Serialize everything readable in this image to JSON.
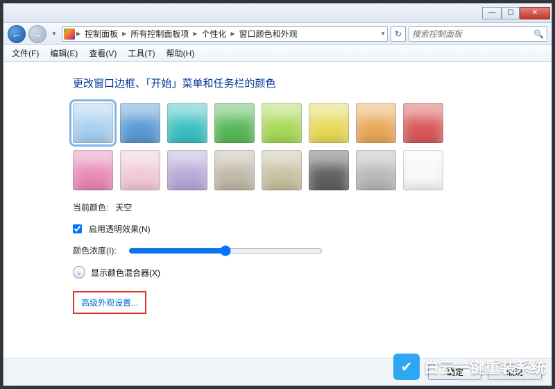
{
  "titlebar": {
    "minimize": "—",
    "maximize": "☐",
    "close": "✕"
  },
  "nav": {
    "back_icon": "←",
    "forward_icon": "→",
    "dropdown": "▼",
    "crumbs": [
      "控制面板",
      "所有控制面板项",
      "个性化",
      "窗口颜色和外观"
    ],
    "refresh_icon": "↻",
    "search_placeholder": "搜索控制面板",
    "search_icon": "🔍"
  },
  "menu": {
    "file": "文件(F)",
    "edit": "编辑(E)",
    "view": "查看(V)",
    "tools": "工具(T)",
    "help": "帮助(H)"
  },
  "page": {
    "heading": "更改窗口边框、「开始」菜单和任务栏的颜色",
    "swatches": [
      {
        "name": "天空",
        "hex": "#a8d0f0",
        "selected": true
      },
      {
        "name": "蓝",
        "hex": "#5a9ad4"
      },
      {
        "name": "青",
        "hex": "#3cc0c0"
      },
      {
        "name": "绿",
        "hex": "#58b858"
      },
      {
        "name": "浅绿",
        "hex": "#a8d858"
      },
      {
        "name": "黄",
        "hex": "#e8d858"
      },
      {
        "name": "橙",
        "hex": "#e8a858"
      },
      {
        "name": "红",
        "hex": "#d85858"
      },
      {
        "name": "粉",
        "hex": "#e888b8"
      },
      {
        "name": "浅粉",
        "hex": "#f0c8d8"
      },
      {
        "name": "紫",
        "hex": "#b8a8d8"
      },
      {
        "name": "灰",
        "hex": "#c0b8a8"
      },
      {
        "name": "卡其",
        "hex": "#c8c0a0"
      },
      {
        "name": "深灰",
        "hex": "#606060"
      },
      {
        "name": "银",
        "hex": "#b8b8b8"
      },
      {
        "name": "白",
        "hex": "#f8f8f8"
      }
    ],
    "current_label": "当前颜色:",
    "current_value": "天空",
    "transparency_label": "启用透明效果(N)",
    "transparency_checked": true,
    "intensity_label": "颜色浓度(I):",
    "intensity_value": 50,
    "mixer_label": "显示颜色混合器(X)",
    "mixer_icon": "⌄",
    "advanced_link": "高级外观设置..."
  },
  "footer": {
    "ok": "确定",
    "cancel": "取消"
  },
  "watermark": {
    "badge": "✔",
    "text": "白云一键重装系统",
    "url": "www.baiyunxitong.com"
  }
}
